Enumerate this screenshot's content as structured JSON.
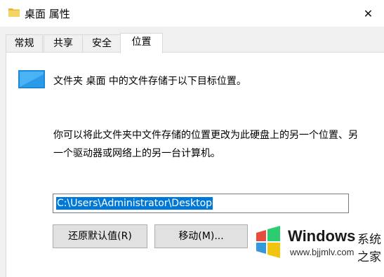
{
  "window": {
    "title": "桌面 属性",
    "close_glyph": "✕"
  },
  "tabs": [
    {
      "label": "常规",
      "active": false
    },
    {
      "label": "共享",
      "active": false
    },
    {
      "label": "安全",
      "active": false
    },
    {
      "label": "位置",
      "active": true
    }
  ],
  "location": {
    "description": "文件夹 桌面 中的文件存储于以下目标位置。",
    "paragraph": "你可以将此文件夹中文件存储的位置更改为此硬盘上的另一个位置、另一个驱动器或网络上的另一台计算机。",
    "path_value": "C:\\Users\\Administrator\\Desktop"
  },
  "buttons": {
    "restore_label": "还原默认值(R)",
    "move_label": "移动(M)..."
  },
  "watermark": {
    "brand": "Windows",
    "suffix": "系统之家",
    "url": "www.bjjmlv.com"
  },
  "colors": {
    "accent": "#0078d7",
    "folder_yellow": "#f4c542"
  }
}
